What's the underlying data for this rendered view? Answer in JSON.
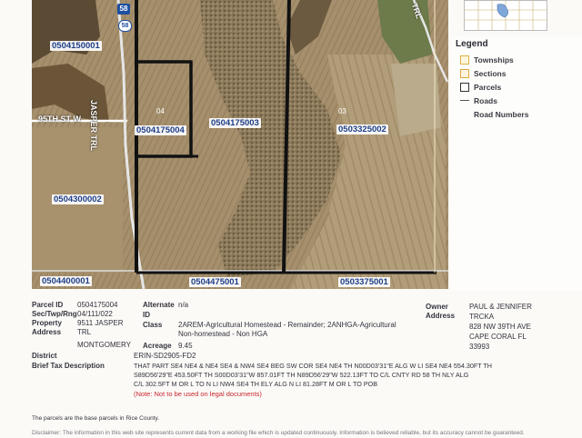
{
  "map": {
    "road_sign": "58",
    "road_label_jasper": "JASPER TRL",
    "road_label_95th": "95TH ST W",
    "road_label_ne": "TRL",
    "section_04": "04",
    "section_03": "03",
    "parcels": [
      {
        "id": "p1",
        "label": "0504150001"
      },
      {
        "id": "p2",
        "label": "0504175003"
      },
      {
        "id": "p3",
        "label": "0504175004"
      },
      {
        "id": "p4",
        "label": "0503325002"
      },
      {
        "id": "p5",
        "label": "0504300002"
      },
      {
        "id": "p6",
        "label": "0504400001"
      },
      {
        "id": "p7",
        "label": "0504475001"
      },
      {
        "id": "p8",
        "label": "0503375001"
      }
    ]
  },
  "legend": {
    "title": "Legend",
    "items": [
      {
        "label": "Townships",
        "type": "box",
        "color": "#d8b44a"
      },
      {
        "label": "Sections",
        "type": "box",
        "color": "#e0a83a"
      },
      {
        "label": "Parcels",
        "type": "box",
        "color": "#333333"
      },
      {
        "label": "Roads",
        "type": "line",
        "color": "#555555"
      },
      {
        "label": "Road Numbers",
        "type": "none",
        "color": ""
      }
    ]
  },
  "info": {
    "parcel_id_label": "Parcel ID",
    "parcel_id": "0504175004",
    "sec_label": "Sec/Twp/Rng",
    "sec": "04/111/022",
    "property_label": "Property",
    "property_1": "9511 JASPER",
    "address_label": "Address",
    "property_2": "TRL",
    "property_3": "MONTGOMERY",
    "alternate_label": "Alternate",
    "alternate": "n/a",
    "alternate_id_label": "ID",
    "class_label": "Class",
    "class_1": "2AREM-Agricultural Homestead - Remainder; 2ANHGA-Agricultural",
    "class_2": "Non-homestead - Non HGA",
    "acreage_label": "Acreage",
    "acreage": "9.45",
    "owner_label": "Owner",
    "owner_address_label": "Address",
    "owner_1": "PAUL & JENNIFER",
    "owner_2": "TRCKA",
    "owner_3": "828 NW 39TH AVE",
    "owner_4": "CAPE CORAL FL",
    "owner_5": "33993",
    "district_label": "District",
    "district": "ERIN-SD2905-FD2",
    "brief_label": "Brief Tax Description",
    "brief_1": "THAT PART SE4 NE4 & NE4 SE4 & NW4 SE4 BEG SW COR SE4 NE4 TH N00D03'31\"E ALG W LI SE4 NE4 554.30FT TH",
    "brief_2": "S89D56'29\"E 453.50FT TH S00D03'31\"W 857.01FT TH N89D56'29\"W 522.13FT TO C/L CNTY RD 58 TH NLY ALG",
    "brief_3": "C/L 302.5FT M OR L TO N LI NW4 SE4 TH ELY ALG N LI 81.28FT M OR L TO POB",
    "note": "(Note: Not to be used on legal documents)",
    "footer": "The parcels are the base parcels in Rice County.",
    "disclaimer": "Disclaimer: The information in this web site represents current data from a working file which is updated continuously. Information is believed reliable, but its accuracy cannot be guaranteed."
  }
}
